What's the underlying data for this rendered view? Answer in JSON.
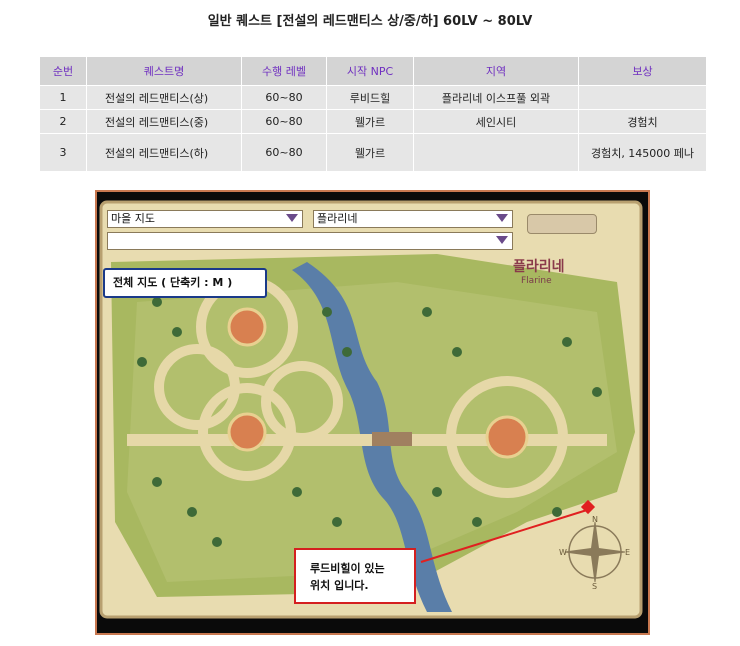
{
  "page_title": "일반 퀘스트 [전설의 레드맨티스 상/중/하] 60LV ~ 80LV",
  "table": {
    "headers": [
      "순번",
      "퀘스트명",
      "수행 레벨",
      "시작 NPC",
      "지역",
      "보상"
    ],
    "rows": [
      [
        "1",
        "전설의 레드맨티스(상)",
        "60~80",
        "루비드힐",
        "플라리네 이스프풀 외곽",
        ""
      ],
      [
        "2",
        "전설의 레드맨티스(중)",
        "60~80",
        "웰가르",
        "세인시티",
        "경험치"
      ],
      [
        "3",
        "전설의 레드맨티스(하)",
        "60~80",
        "웰가르",
        "",
        "경험치, 145000 페나"
      ]
    ]
  },
  "map": {
    "dropdown_type": "마을 지도",
    "dropdown_town": "플라리네",
    "dropdown_sub": "",
    "town_label": "플라리네",
    "town_label_sub": "Flarine",
    "full_map_label": "전체 지도 ( 단축키 : M )",
    "callout_line1": "루드비힐이 있는",
    "callout_line2": "위치 입니다.",
    "compass_letters": [
      "N",
      "E",
      "S",
      "W"
    ]
  },
  "colors": {
    "header_text": "#7030c0",
    "frame_border": "#c87850",
    "callout_border": "#d42020",
    "label_border": "#1a3a8a"
  }
}
